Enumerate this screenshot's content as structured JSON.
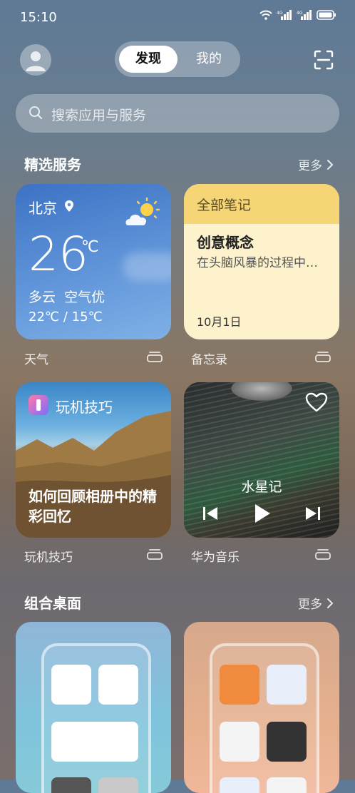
{
  "status": {
    "time": "15:10",
    "net1": "4G",
    "net2": "4G"
  },
  "tabs": {
    "active": "发现",
    "inactive": "我的"
  },
  "search": {
    "placeholder": "搜索应用与服务"
  },
  "featured": {
    "title": "精选服务",
    "more": "更多",
    "weather": {
      "city": "北京",
      "temp": "26",
      "unit": "℃",
      "condition": "多云  空气优",
      "range": "22℃ / 15℃",
      "app": "天气"
    },
    "memo": {
      "header": "全部笔记",
      "title": "创意概念",
      "snippet": "在头脑风暴的过程中…",
      "date": "10月1日",
      "app": "备忘录"
    },
    "tips": {
      "name": "玩机技巧",
      "desc": "如何回顾相册中的精彩回忆",
      "app": "玩机技巧"
    },
    "music": {
      "song": "水星记",
      "app": "华为音乐"
    }
  },
  "combos": {
    "title": "组合桌面",
    "more": "更多"
  }
}
